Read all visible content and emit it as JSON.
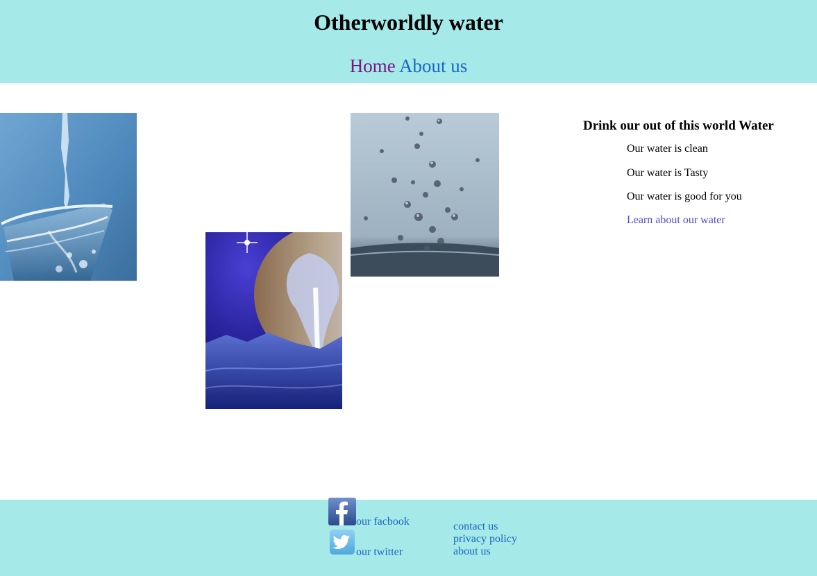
{
  "header": {
    "title": "Otherworldly water",
    "nav": [
      {
        "label": "Home",
        "color": "#7a1682"
      },
      {
        "label": "About us",
        "color": "#1a66c2"
      }
    ],
    "background": "#a5e9e9"
  },
  "gallery": [
    {
      "subject": "water pouring into a glass"
    },
    {
      "subject": "geyser erupting on an icy moon"
    },
    {
      "subject": "water droplets splashing"
    }
  ],
  "promo": {
    "title": "Drink our out of this world Water",
    "items": [
      "Our water is clean",
      "Our water is Tasty",
      "Our water is good for you"
    ],
    "link_label": "Learn about our water",
    "link_color": "#4b4bd6"
  },
  "footer": {
    "social": [
      {
        "icon": "facebook-icon",
        "label": "our facbook"
      },
      {
        "icon": "twitter-icon",
        "label": "our twitter"
      }
    ],
    "links": [
      "contact us",
      "privacy policy",
      "about us"
    ],
    "background": "#a5e9e9"
  }
}
